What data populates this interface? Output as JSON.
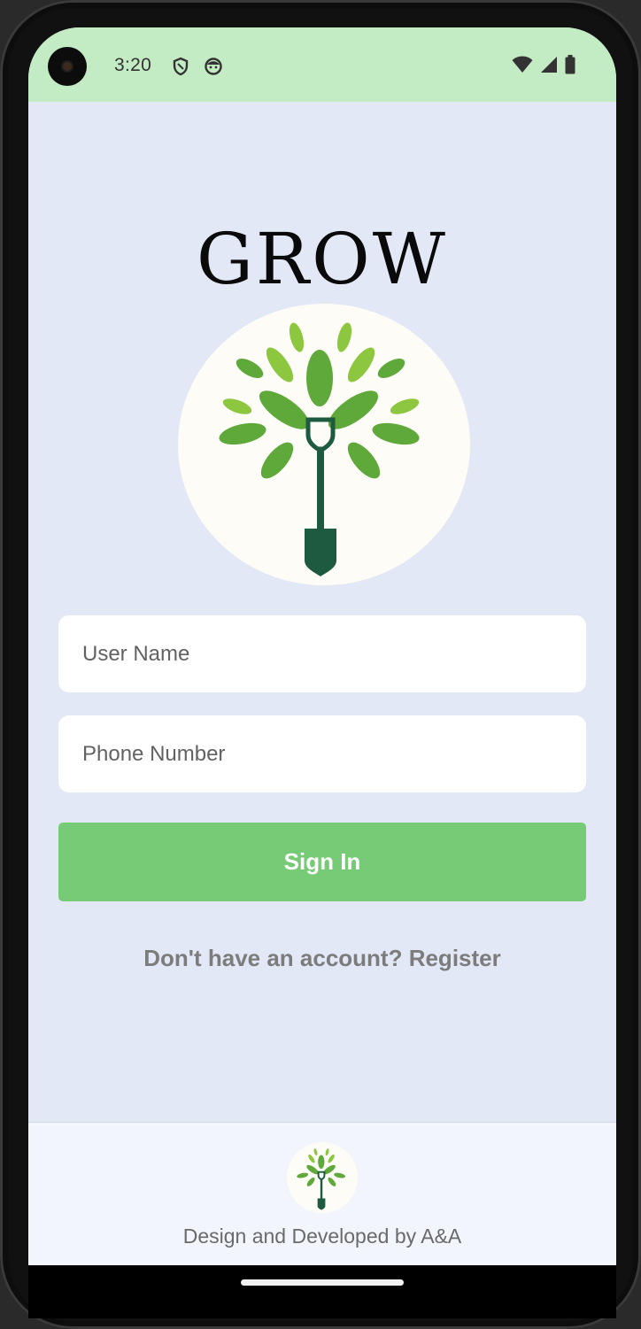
{
  "status_bar": {
    "time": "3:20",
    "left_icons": [
      "shield-icon",
      "face-icon"
    ],
    "right_icons": [
      "wifi-icon",
      "cellular-signal-icon",
      "battery-icon"
    ],
    "background_color": "#c4ecc4"
  },
  "brand": {
    "title": "GROW",
    "logo_icon": "tree-shovel-logo-icon"
  },
  "form": {
    "username_placeholder": "User Name",
    "phone_placeholder": "Phone Number",
    "signin_label": "Sign In",
    "register_text": "Don't have an account? Register"
  },
  "footer": {
    "logo_icon": "tree-shovel-logo-icon",
    "credits": "Design and Developed by A&A"
  },
  "colors": {
    "background": "#e3e8f6",
    "button": "#77cb77",
    "leaf_light": "#8dc63f",
    "leaf_dark": "#5fa83a",
    "shovel": "#1e5a40"
  }
}
